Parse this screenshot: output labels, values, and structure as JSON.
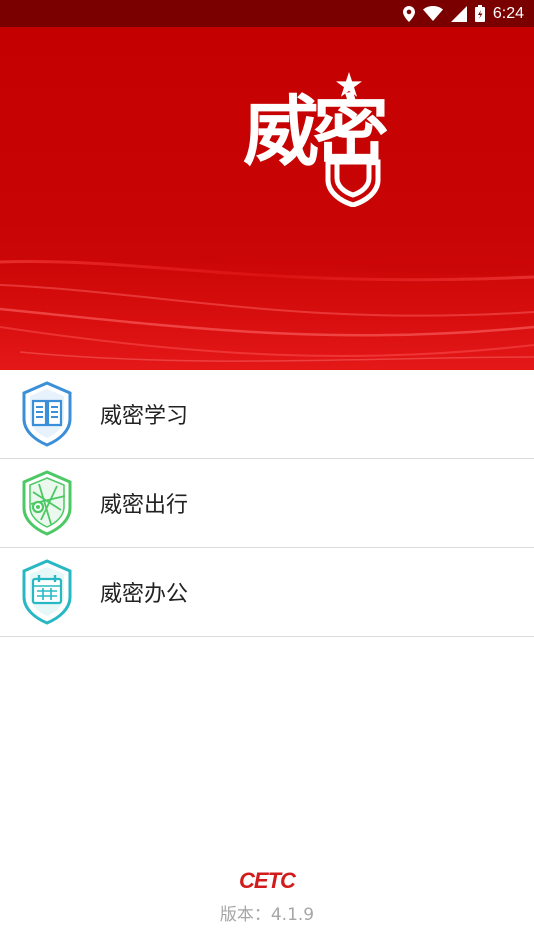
{
  "status_bar": {
    "time": "6:24",
    "icons": [
      "location-icon",
      "wifi-icon",
      "cell-signal-icon",
      "battery-icon"
    ]
  },
  "hero": {
    "logo_text": "威密"
  },
  "menu": {
    "items": [
      {
        "label": "威密学习",
        "icon": "book-shield-icon",
        "color": "#3b8fd8"
      },
      {
        "label": "威密出行",
        "icon": "map-shield-icon",
        "color": "#4cc964"
      },
      {
        "label": "威密办公",
        "icon": "calendar-shield-icon",
        "color": "#28b8c4"
      }
    ]
  },
  "footer": {
    "brand": "CETC",
    "version_label": "版本：",
    "version": "4.1.9"
  },
  "colors": {
    "status_bar": "#7a0000",
    "hero": "#c40000",
    "brand": "#d21c1c"
  }
}
